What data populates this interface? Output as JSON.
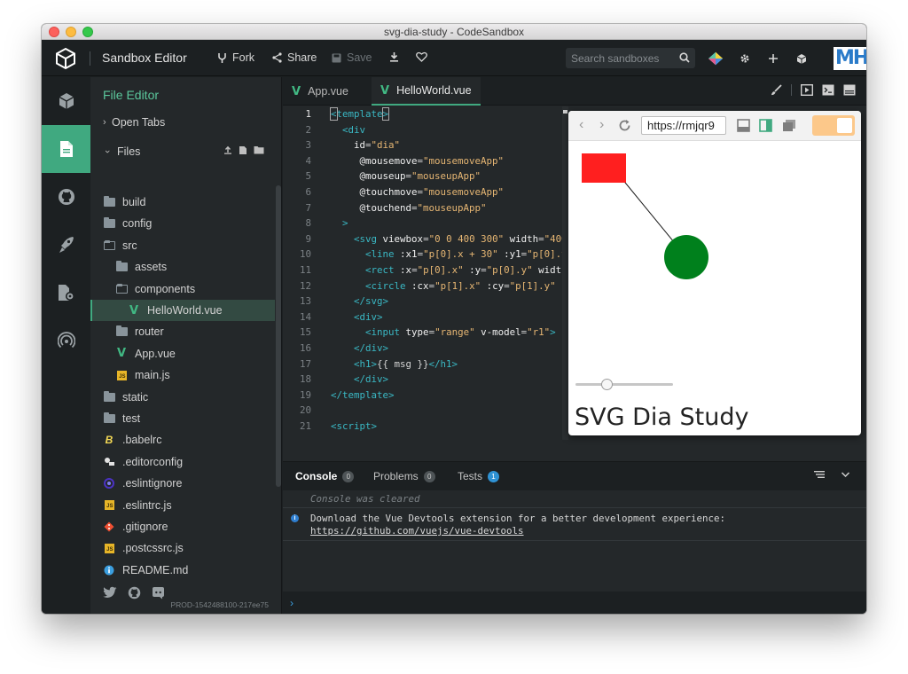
{
  "window": {
    "title": "svg-dia-study - CodeSandbox"
  },
  "topbar": {
    "app_title": "Sandbox Editor",
    "fork": "Fork",
    "share": "Share",
    "save": "Save",
    "search_placeholder": "Search sandboxes",
    "avatar_text": "MH"
  },
  "sidebar": {
    "title": "File Editor",
    "open_tabs": "Open Tabs",
    "files_label": "Files",
    "tree": [
      {
        "label": "build",
        "type": "folder"
      },
      {
        "label": "config",
        "type": "folder"
      },
      {
        "label": "src",
        "type": "folder-open"
      },
      {
        "label": "assets",
        "type": "folder"
      },
      {
        "label": "components",
        "type": "folder-open"
      },
      {
        "label": "HelloWorld.vue",
        "type": "vue"
      },
      {
        "label": "router",
        "type": "folder"
      },
      {
        "label": "App.vue",
        "type": "vue"
      },
      {
        "label": "main.js",
        "type": "js"
      },
      {
        "label": "static",
        "type": "folder"
      },
      {
        "label": "test",
        "type": "folder"
      },
      {
        "label": ".babelrc",
        "type": "babel"
      },
      {
        "label": ".editorconfig",
        "type": "editorconfig"
      },
      {
        "label": ".eslintignore",
        "type": "eslint"
      },
      {
        "label": ".eslintrc.js",
        "type": "js"
      },
      {
        "label": ".gitignore",
        "type": "git"
      },
      {
        "label": ".postcssrc.js",
        "type": "js"
      },
      {
        "label": "README.md",
        "type": "info"
      }
    ],
    "build_id": "PROD-1542488100-217ee75"
  },
  "tabs": [
    {
      "label": "App.vue",
      "active": false
    },
    {
      "label": "HelloWorld.vue",
      "active": true
    }
  ],
  "editor": {
    "line_numbers": [
      "1",
      "2",
      "3",
      "4",
      "5",
      "6",
      "7",
      "8",
      "9",
      "10",
      "11",
      "12",
      "13",
      "14",
      "15",
      "16",
      "17",
      "18",
      "19",
      "20",
      "21"
    ],
    "active_line": "1"
  },
  "preview": {
    "url": "https://rmjqr9",
    "heading": "SVG Dia Study",
    "slider_value": 0.3,
    "colors": {
      "rect": "#ff1f1f",
      "circle": "#00801c",
      "toggle": "#fcc88a"
    }
  },
  "console": {
    "tabs": [
      {
        "label": "Console",
        "count": "0"
      },
      {
        "label": "Problems",
        "count": "0"
      },
      {
        "label": "Tests",
        "count": "1"
      }
    ],
    "cleared": "Console was cleared",
    "message": "Download the Vue Devtools extension for a better development experience:",
    "link": "https://github.com/vuejs/vue-devtools",
    "prompt": "›"
  },
  "accent": "#40a980"
}
